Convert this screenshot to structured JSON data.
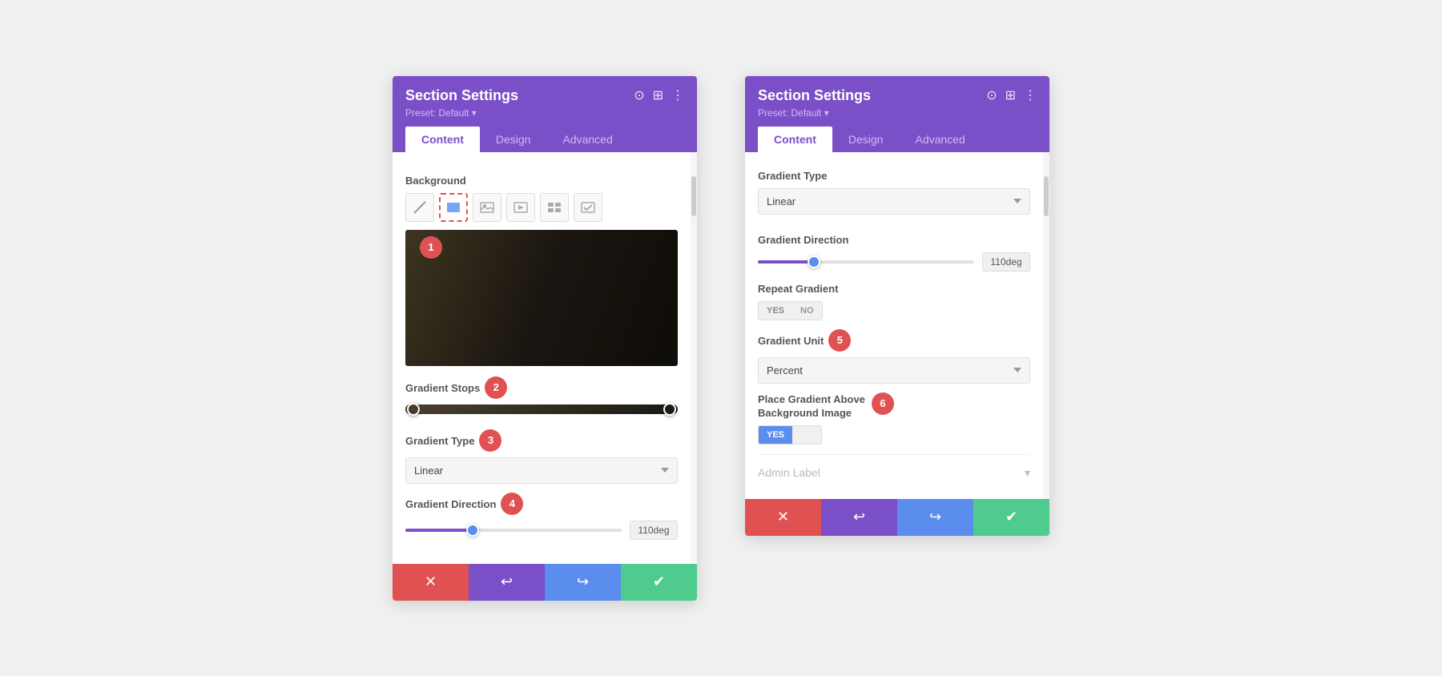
{
  "left_panel": {
    "title": "Section Settings",
    "preset": "Preset: Default ▾",
    "tabs": [
      "Content",
      "Design",
      "Advanced"
    ],
    "active_tab": "Content",
    "background_label": "Background",
    "bg_icons": [
      "🚫",
      "🖼",
      "🖼",
      "▣",
      "✉",
      "✔"
    ],
    "badge_1": "1",
    "gradient_stops_label": "Gradient Stops",
    "badge_2": "2",
    "gradient_type_label": "Gradient Type",
    "badge_3": "3",
    "gradient_type_value": "Linear",
    "gradient_direction_label": "Gradient Direction",
    "badge_4": "4",
    "direction_value": "110deg",
    "direction_percent": 30,
    "footer": {
      "cancel": "✕",
      "undo": "↩",
      "redo": "↪",
      "save": "✔"
    }
  },
  "right_panel": {
    "title": "Section Settings",
    "preset": "Preset: Default ▾",
    "tabs": [
      "Content",
      "Design",
      "Advanced"
    ],
    "active_tab": "Content",
    "gradient_type_label": "Gradient Type",
    "gradient_type_value": "Linear",
    "gradient_direction_label": "Gradient Direction",
    "direction_value": "110deg",
    "direction_percent": 25,
    "repeat_gradient_label": "Repeat Gradient",
    "repeat_no": "NO",
    "gradient_unit_label": "Gradient Unit",
    "badge_5": "5",
    "gradient_unit_value": "Percent",
    "place_gradient_label": "Place Gradient Above",
    "place_gradient_label2": "Background Image",
    "badge_6": "6",
    "toggle_yes": "YES",
    "toggle_no": "",
    "admin_label": "Admin Label",
    "footer": {
      "cancel": "✕",
      "undo": "↩",
      "redo": "↪",
      "save": "✔"
    }
  }
}
